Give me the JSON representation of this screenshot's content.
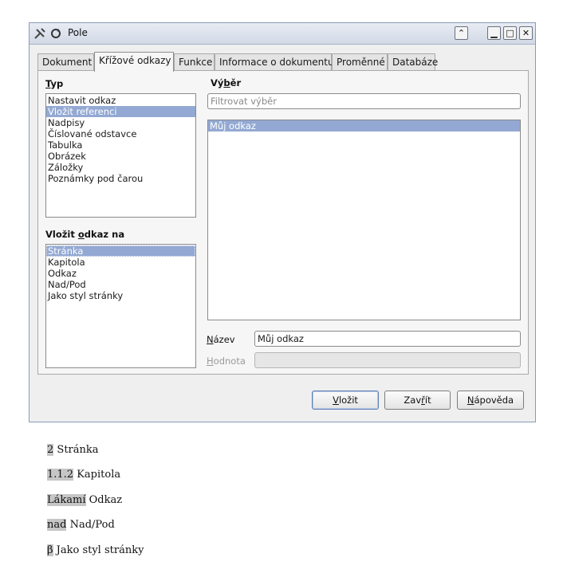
{
  "window": {
    "title": "Pole",
    "controls": {
      "up": "⌃",
      "minimize": "▁",
      "maximize": "□",
      "close": "✕"
    }
  },
  "tabs": [
    "Dokument",
    "Křížové odkazy",
    "Funkce",
    "Informace o dokumentu",
    "Proměnné",
    "Databáze"
  ],
  "active_tab": "Křížové odkazy",
  "type_section": {
    "label_mnemonic": "T",
    "label_rest": "yp",
    "items": [
      "Nastavit odkaz",
      "Vložit referenci",
      "Nadpisy",
      "Číslované odstavce",
      "Tabulka",
      "Obrázek",
      "Záložky",
      "Poznámky pod čarou"
    ],
    "selected_index": 1
  },
  "insert_ref_section": {
    "label_before": "Vložit ",
    "label_mnemonic": "o",
    "label_after": "dkaz na",
    "items": [
      "Stránka",
      "Kapitola",
      "Odkaz",
      "Nad/Pod",
      "Jako styl stránky"
    ],
    "selected_index": 0
  },
  "selection_section": {
    "label_before": "Vý",
    "label_mnemonic": "b",
    "label_after": "ěr",
    "filter_placeholder": "Filtrovat výběr",
    "items": [
      "Můj odkaz"
    ],
    "selected_index": 0
  },
  "name_field": {
    "label_mnemonic": "N",
    "label_rest": "ázev",
    "value": "Můj odkaz"
  },
  "value_field": {
    "label_mnemonic": "H",
    "label_rest": "odnota",
    "value": ""
  },
  "buttons": {
    "insert_mnemonic": "V",
    "insert_rest": "ložit",
    "close_before": "Zav",
    "close_mnemonic": "ř",
    "close_after": "ít",
    "help_mnemonic": "N",
    "help_rest": "ápověda"
  },
  "document": {
    "lines": [
      {
        "field": "2",
        "text": " Stránka"
      },
      {
        "field": "1.1.2",
        "text": " Kapitola"
      },
      {
        "field": "Lákamí",
        "text": " Odkaz"
      },
      {
        "field": "nad",
        "text": " Nad/Pod"
      },
      {
        "field": "β",
        "text": " Jako styl stránky"
      }
    ]
  },
  "colors": {
    "selection": "#93a9d3",
    "field_shading": "#c6c6c6",
    "window_border": "#8a9ab8"
  }
}
